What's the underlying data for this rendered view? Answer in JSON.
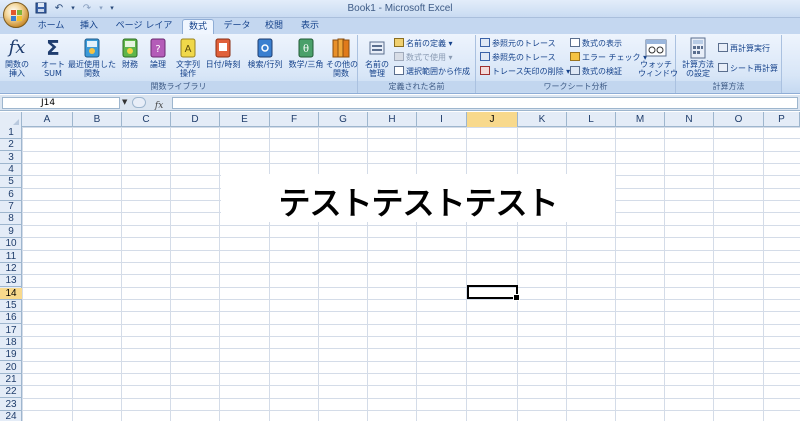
{
  "window": {
    "title": "Book1 - Microsoft Excel"
  },
  "tabs": [
    "ホーム",
    "挿入",
    "ページ レイアウト",
    "数式",
    "データ",
    "校閲",
    "表示"
  ],
  "active_tab": "数式",
  "ribbon": {
    "function_library": {
      "label": "関数ライブラリ",
      "insert_function": "関数の\n挿入",
      "autosum": "オート\nSUM",
      "recent": "最近使用した\n関数",
      "financial": "財務",
      "logical": "論理",
      "text": "文字列\n操作",
      "datetime": "日付/時刻",
      "lookup": "検索/行列",
      "math": "数学/三角",
      "more": "その他の\n関数"
    },
    "defined_names": {
      "label": "定義された名前",
      "name_manager": "名前の\n管理",
      "define_name": "名前の定義",
      "use_in_formula": "数式で使用",
      "create_from_selection": "選択範囲から作成"
    },
    "formula_auditing": {
      "label": "ワークシート分析",
      "trace_precedents": "参照元のトレース",
      "trace_dependents": "参照先のトレース",
      "remove_arrows": "トレース矢印の削除",
      "show_formulas": "数式の表示",
      "error_checking": "エラー チェック",
      "evaluate_formula": "数式の検証",
      "watch_window": "ウォッチ\nウィンドウ"
    },
    "calculation": {
      "label": "計算方法",
      "calc_options": "計算方法\nの設定",
      "calc_now": "再計算実行",
      "calc_sheet": "シート再計算"
    }
  },
  "formula_bar": {
    "name_box": "J14",
    "fx": "fx",
    "formula": ""
  },
  "columns": [
    "A",
    "B",
    "C",
    "D",
    "E",
    "F",
    "G",
    "H",
    "I",
    "J",
    "K",
    "L",
    "M",
    "N",
    "O",
    "P"
  ],
  "selected_column": "J",
  "rows": [
    "1",
    "2",
    "3",
    "4",
    "5",
    "6",
    "7",
    "8",
    "9",
    "10",
    "11",
    "12",
    "13",
    "14",
    "15",
    "16",
    "17",
    "18",
    "19",
    "20",
    "21",
    "22",
    "23",
    "24"
  ],
  "selected_row": "14",
  "textbox_text": "テストテストテスト",
  "colors": {
    "selection_header": "#f8d98c",
    "ribbon_bg": "#d8e6f7",
    "grid_line": "#d4dce8"
  }
}
